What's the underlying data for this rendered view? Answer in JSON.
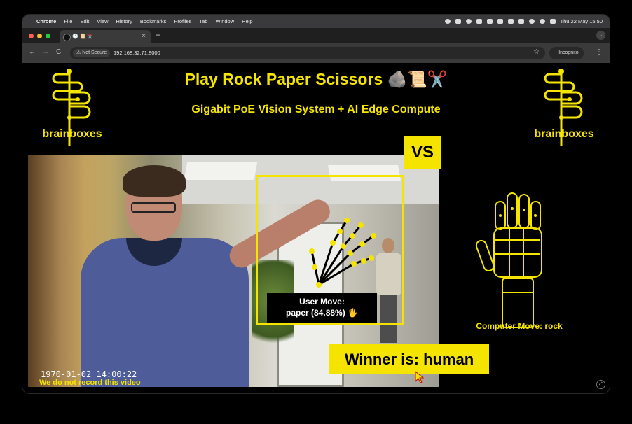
{
  "menubar": {
    "app": "Chrome",
    "items": [
      "File",
      "Edit",
      "View",
      "History",
      "Bookmarks",
      "Profiles",
      "Tab",
      "Window",
      "Help"
    ],
    "clock": "Thu 22 May  15:50"
  },
  "tab": {
    "title": "🕐 📜 ✂️",
    "close": "×",
    "new": "+"
  },
  "toolbar": {
    "back": "←",
    "forward": "→",
    "reload": "C",
    "security_label": "⚠ Not Secure",
    "url": "192.168.32.71:8000",
    "bookmark_star": "☆",
    "incognito_label": "Incognito",
    "menu": "⋮"
  },
  "page": {
    "title": "Play Rock Paper Scissors 🪨📜✂️",
    "subtitle": "Gigabit PoE Vision System + AI Edge Compute",
    "brand": "brainboxes",
    "vs": "VS",
    "user_move_label": "User Move:",
    "user_move_value": "paper (84.88%) 🖐",
    "timestamp": "1970-01-02  14:00:22",
    "no_record_notice": "We do not record this video",
    "winner": "Winner is: human",
    "computer_move": "Computer Move: rock"
  },
  "colors": {
    "accent_yellow": "#f5e400",
    "menubar_bg": "#3a3a3c",
    "toolbar_bg": "#3a3a3a",
    "page_bg": "#000000"
  }
}
